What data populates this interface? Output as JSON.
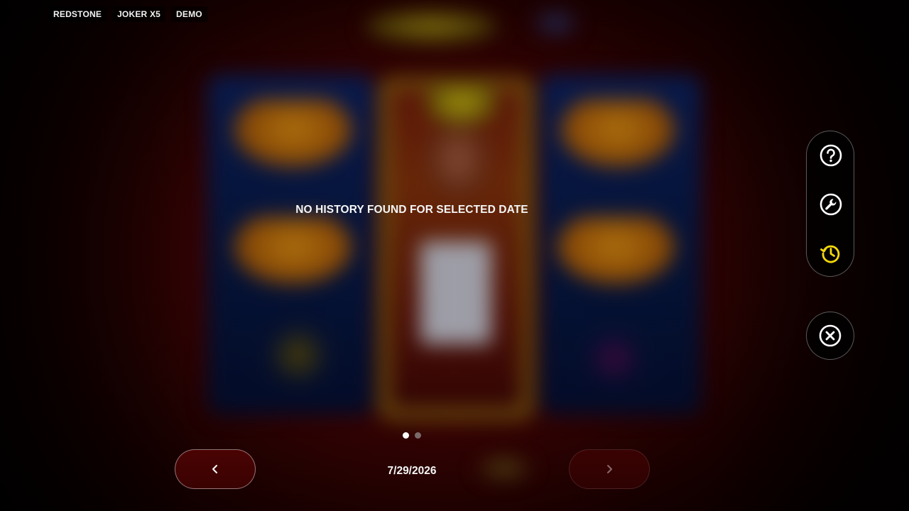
{
  "header": {
    "tags": [
      "REDSTONE",
      "JOKER X5",
      "DEMO"
    ]
  },
  "message": "NO HISTORY FOUND FOR SELECTED DATE",
  "side_menu": {
    "items": [
      {
        "icon": "help-icon",
        "active": false
      },
      {
        "icon": "wrench-icon",
        "active": false
      },
      {
        "icon": "history-icon",
        "active": true
      }
    ],
    "active_color": "#f5d90a"
  },
  "close": {
    "icon": "close-icon"
  },
  "pagination": {
    "pages": 2,
    "current": 1
  },
  "navigation": {
    "date": "7/29/2026",
    "prev_icon": "chevron-left-icon",
    "next_icon": "chevron-right-icon",
    "next_enabled": false
  }
}
